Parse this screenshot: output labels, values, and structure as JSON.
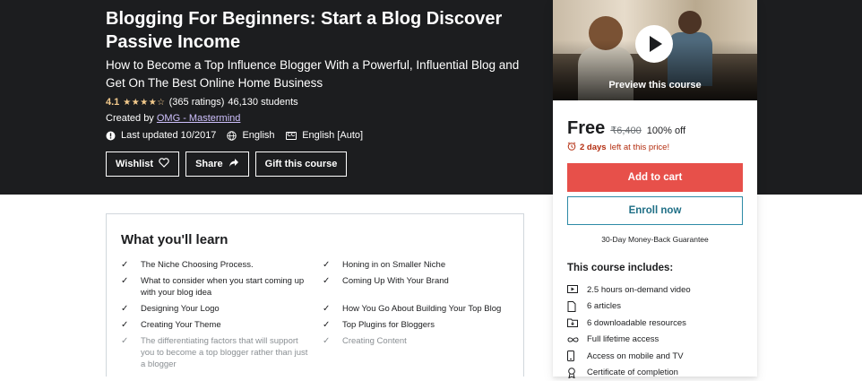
{
  "hero": {
    "title": "Blogging For Beginners: Start a Blog Discover Passive Income",
    "subtitle": "How to Become a Top Influence Blogger With a Powerful, Influential Blog and Get On The Best Online Home Business",
    "rating": "4.1",
    "stars_value": 4.1,
    "stars_glyphs": "★★★★☆",
    "ratings_count": "(365 ratings)",
    "students": "46,130 students",
    "created_by_label": "Created by",
    "author": "OMG - Mastermind",
    "last_updated": "Last updated 10/2017",
    "language": "English",
    "captions": "English [Auto]",
    "cc_icon_text": "CC",
    "buttons": {
      "wishlist": "Wishlist",
      "share": "Share",
      "gift": "Gift this course"
    }
  },
  "sidebar": {
    "preview_label": "Preview this course",
    "price": "Free",
    "original_price": "₹6,400",
    "discount": "100% off",
    "timer_bold": "2 days",
    "timer_rest": "left at this price!",
    "add_to_cart": "Add to cart",
    "enroll_now": "Enroll now",
    "guarantee": "30-Day Money-Back Guarantee",
    "includes_title": "This course includes:",
    "includes": [
      {
        "icon": "video-icon",
        "text": "2.5 hours on-demand video"
      },
      {
        "icon": "file-icon",
        "text": "6 articles"
      },
      {
        "icon": "folder-download-icon",
        "text": "6 downloadable resources"
      },
      {
        "icon": "infinity-icon",
        "text": "Full lifetime access"
      },
      {
        "icon": "mobile-icon",
        "text": "Access on mobile and TV"
      },
      {
        "icon": "trophy-icon",
        "text": "Certificate of completion"
      }
    ]
  },
  "learn": {
    "title": "What you'll learn",
    "left": [
      "The Niche Choosing Process.",
      "What to consider when you start coming up with your blog idea",
      "Designing Your Logo",
      "Creating Your Theme",
      "The differentiating factors that will support you to become a top blogger rather than just a blogger"
    ],
    "right": [
      "Honing in on Smaller Niche",
      "Coming Up With Your Brand",
      "How You Go About Building Your Top Blog",
      "Top Plugins for Bloggers",
      "Creating Content"
    ]
  },
  "colors": {
    "hero_bg": "#1c1d1f",
    "star": "#f3ca8c",
    "author_link": "#cec0fc",
    "cart_button": "#e7504a",
    "timer": "#b32d0f"
  }
}
